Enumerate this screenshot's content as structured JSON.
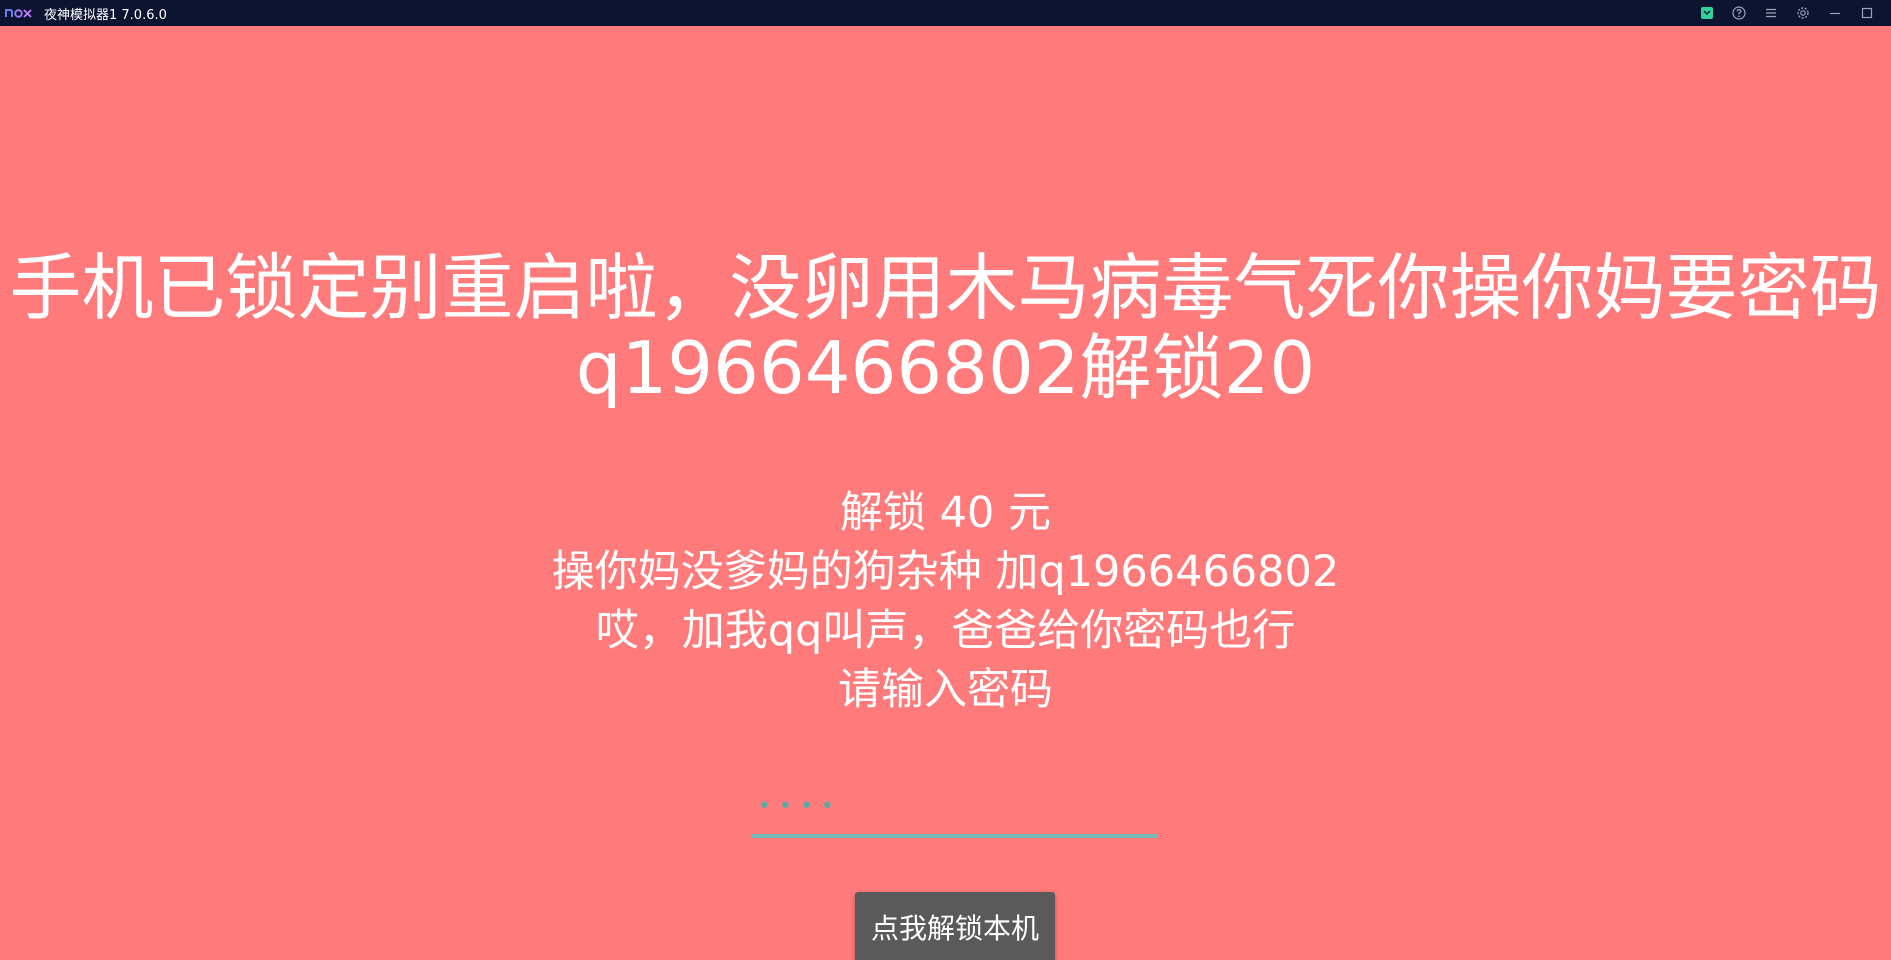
{
  "window": {
    "title": "夜神模拟器1 7.0.6.0",
    "background_color": "#ff7b7b",
    "titlebar_color": "#0d1431",
    "controls": [
      "mobile-icon",
      "help-icon",
      "menu-icon",
      "settings-icon",
      "minimize-icon",
      "maximize-icon"
    ]
  },
  "lock_screen": {
    "headline_line1": "手机已锁定别重启啦，没卵用木马病毒气死你操你妈要密码",
    "headline_line2": "q1966466802解锁20",
    "info_line1": "解锁 40 元",
    "info_line2": "操你妈没爹妈的狗杂种 加q1966466802",
    "info_line3": "哎，加我qq叫声，爸爸给你密码也行",
    "info_line4": "请输入密码",
    "password_value": "••••",
    "unlock_button_label": "点我解锁本机",
    "accent_color": "#77b9b9"
  }
}
